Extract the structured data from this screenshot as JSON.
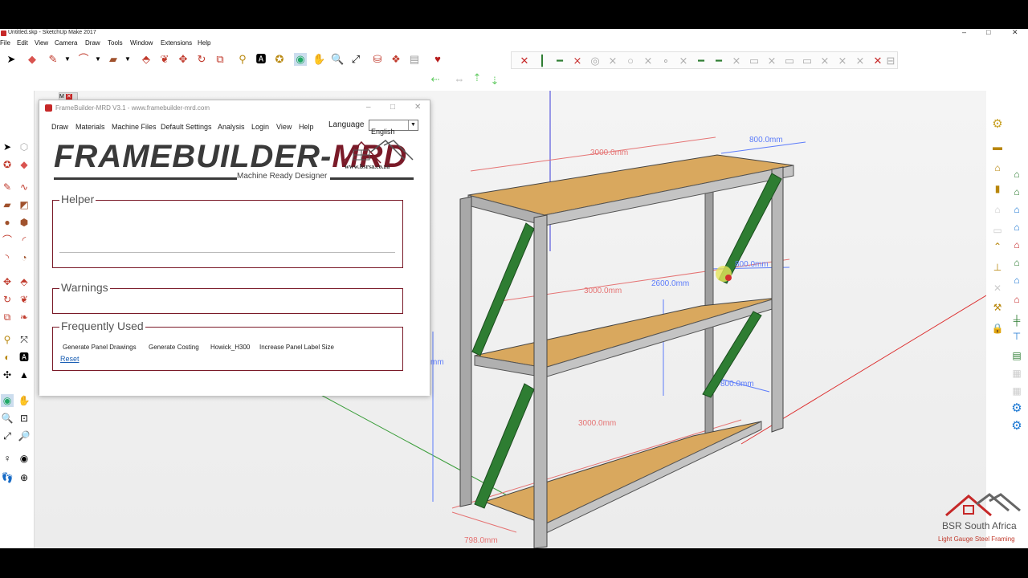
{
  "window": {
    "title": "Untitled.skp - SketchUp Make 2017",
    "controls": [
      "–",
      "□",
      "✕"
    ]
  },
  "menubar": [
    "File",
    "Edit",
    "View",
    "Camera",
    "Draw",
    "Tools",
    "Window",
    "Extensions",
    "Help"
  ],
  "viewport_tag": "M",
  "plugin": {
    "title": "FrameBuilder-MRD V3.1 - www.framebuilder-mrd.com",
    "menu": [
      "Draw",
      "Materials",
      "Machine Files",
      "Default Settings",
      "Analysis",
      "Login",
      "View",
      "Help"
    ],
    "language_label": "Language",
    "language_value": "English",
    "logo_main": "FRAMEBUILDER-",
    "logo_accent": "MRD",
    "logo_sub": "Machine Ready Designer",
    "logo_site": "www.bsrsa.co.za",
    "helper_label": "Helper",
    "warnings_label": "Warnings",
    "frequently_used_label": "Frequently Used",
    "frequently_used": [
      "Generate Panel Drawings",
      "Generate Costing",
      "Howick_H300",
      "Increase Panel Label Size"
    ],
    "reset_label": "Reset"
  },
  "dimensions": {
    "top_length": "3000.0mm",
    "top_depth": "800.0mm",
    "mid_length": "3000.0mm",
    "mid_depth": "800.0mm",
    "height": "2600.0mm",
    "bottom_length": "3000.0mm",
    "bottom_depth": "800.0mm",
    "base_depth": "798.0mm",
    "left_cut": "mm"
  },
  "brand": {
    "name": "BSR South Africa",
    "tagline": "Light Gauge Steel Framing"
  },
  "colors": {
    "accent": "#7a1a28",
    "brace": "#2e7d32",
    "plywood": "#d9a85e",
    "steel": "#a8a8a8"
  }
}
